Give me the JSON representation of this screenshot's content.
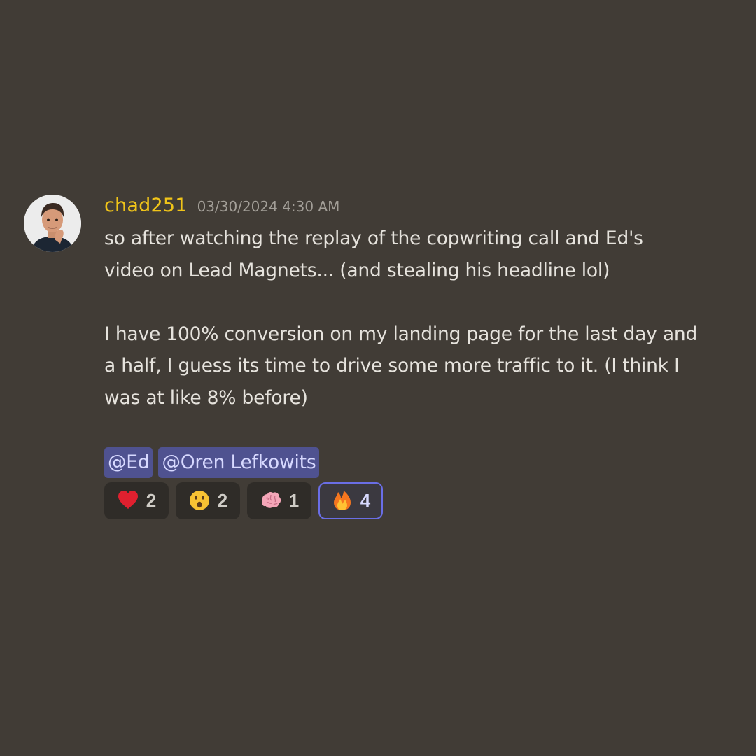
{
  "message": {
    "author": "chad251",
    "timestamp": "03/30/2024 4:30 AM",
    "paragraphs": [
      [
        "so after watching the replay of the copwriting call and Ed's",
        "video on Lead Magnets... (and stealing his headline lol)"
      ],
      [
        "I have 100% conversion on my landing page for the last day and",
        "a half, I guess its time to drive some more traffic to it. (I think I",
        "was at like 8% before)"
      ]
    ],
    "mentions": [
      "@Ed",
      "@Oren Lefkowits"
    ],
    "reactions": [
      {
        "icon": "heart-icon",
        "count": "2",
        "active": false
      },
      {
        "icon": "hushed-face-icon",
        "count": "2",
        "active": false
      },
      {
        "icon": "brain-icon",
        "count": "1",
        "active": false
      },
      {
        "icon": "fire-icon",
        "count": "4",
        "active": true
      }
    ]
  },
  "colors": {
    "background": "#413c36",
    "username": "#f0c419",
    "mention_bg": "#4f5290",
    "active_reaction_border": "#6a6ee6"
  }
}
